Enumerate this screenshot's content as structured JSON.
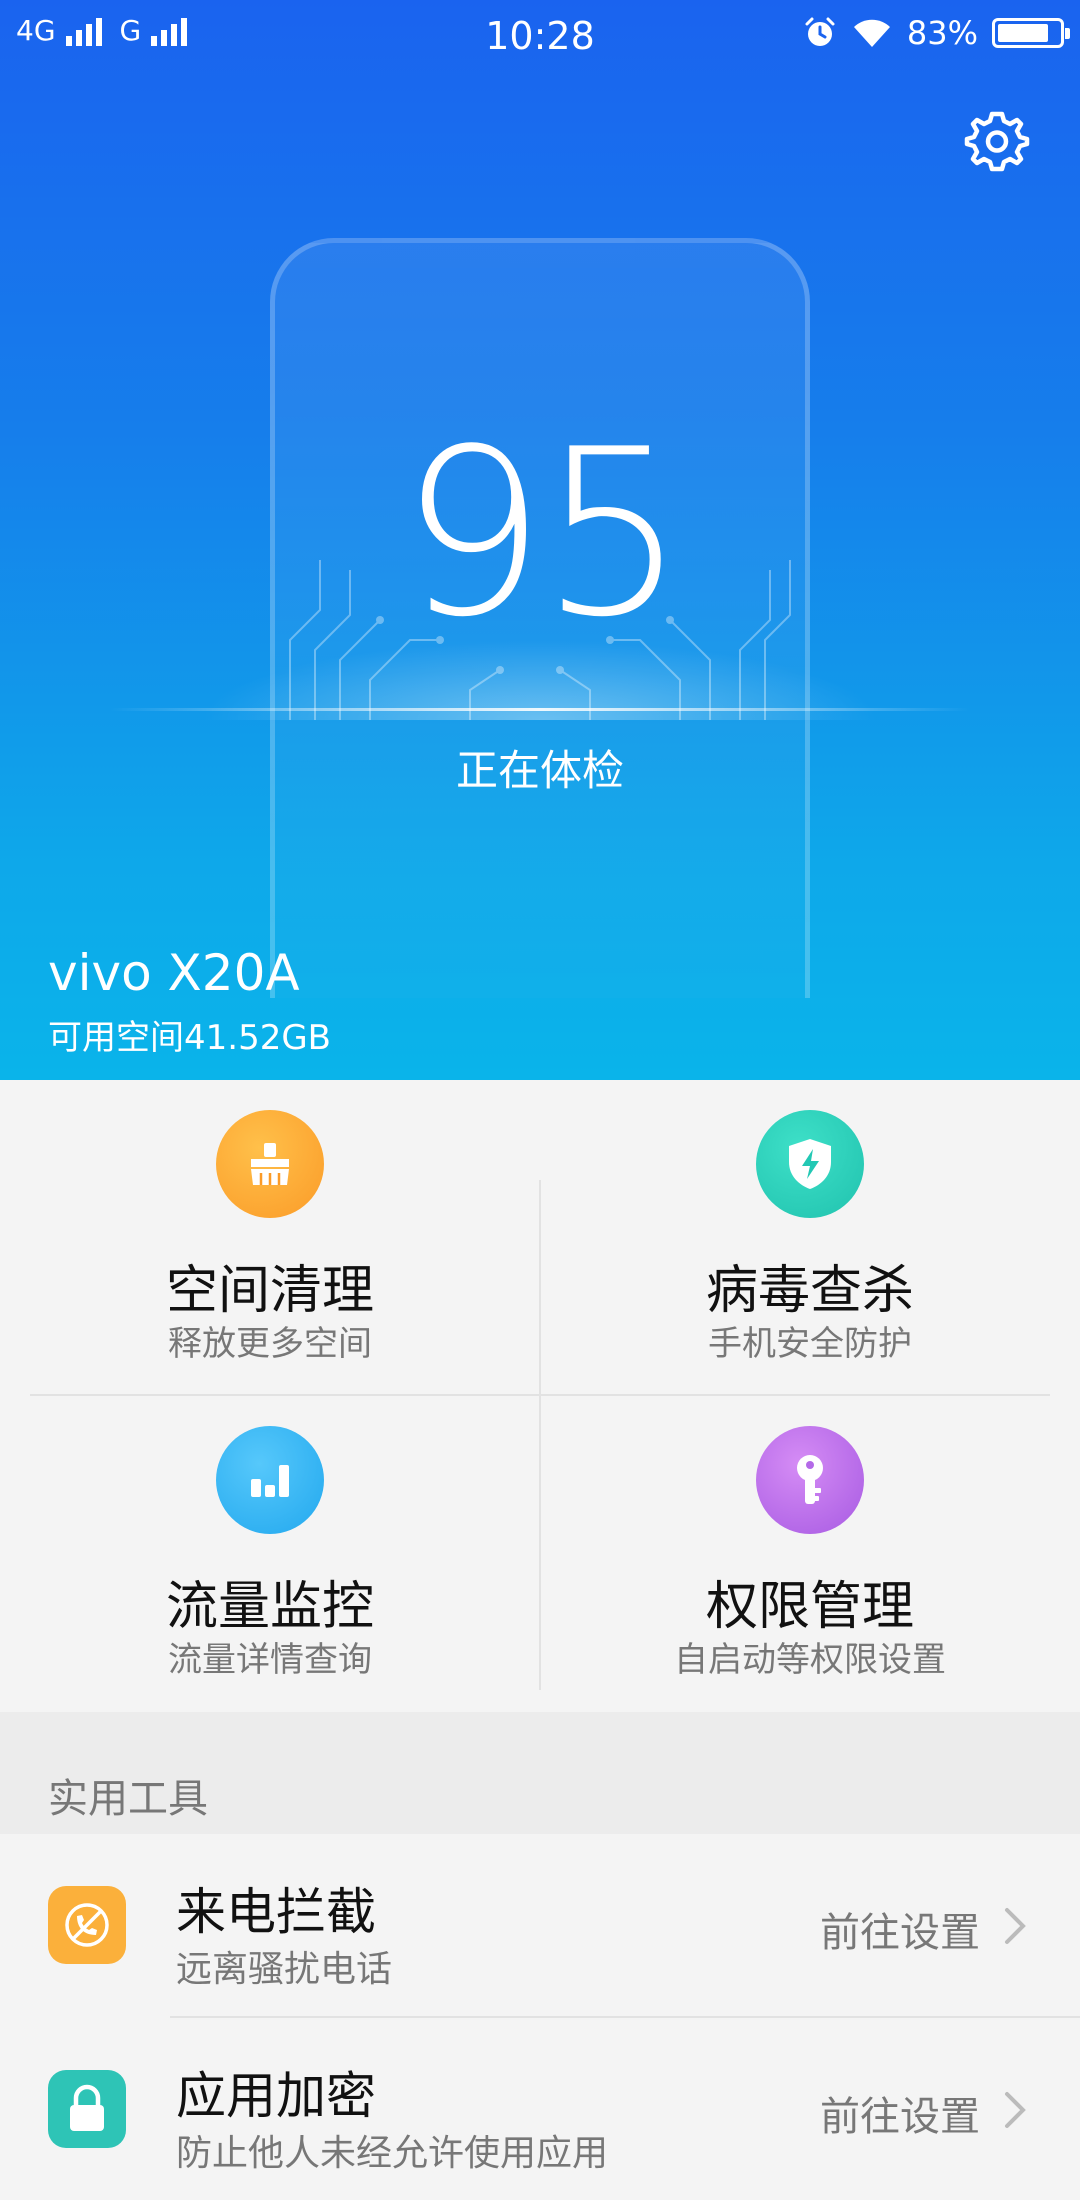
{
  "status_bar": {
    "network1": "4G",
    "network2": "G",
    "time": "10:28",
    "battery_percent": "83%",
    "battery_level": 0.83
  },
  "hero": {
    "score": "95",
    "status": "正在体检",
    "device_name": "vivo X20A",
    "available_space": "可用空间41.52GB"
  },
  "features": [
    {
      "title": "空间清理",
      "subtitle": "释放更多空间",
      "icon": "broom-icon",
      "color": "#fb9b28"
    },
    {
      "title": "病毒查杀",
      "subtitle": "手机安全防护",
      "icon": "shield-bolt-icon",
      "color": "#22c8b4"
    },
    {
      "title": "流量监控",
      "subtitle": "流量详情查询",
      "icon": "bar-chart-icon",
      "color": "#27aef0"
    },
    {
      "title": "权限管理",
      "subtitle": "自启动等权限设置",
      "icon": "key-icon",
      "color": "#b46ae8"
    }
  ],
  "tools": {
    "section_title": "实用工具",
    "items": [
      {
        "title": "来电拦截",
        "subtitle": "远离骚扰电话",
        "action": "前往设置",
        "icon": "phone-block-icon",
        "color": "#fbb03b"
      },
      {
        "title": "应用加密",
        "subtitle": "防止他人未经允许使用应用",
        "action": "前往设置",
        "icon": "lock-icon",
        "color": "#2ec4b6"
      }
    ]
  }
}
